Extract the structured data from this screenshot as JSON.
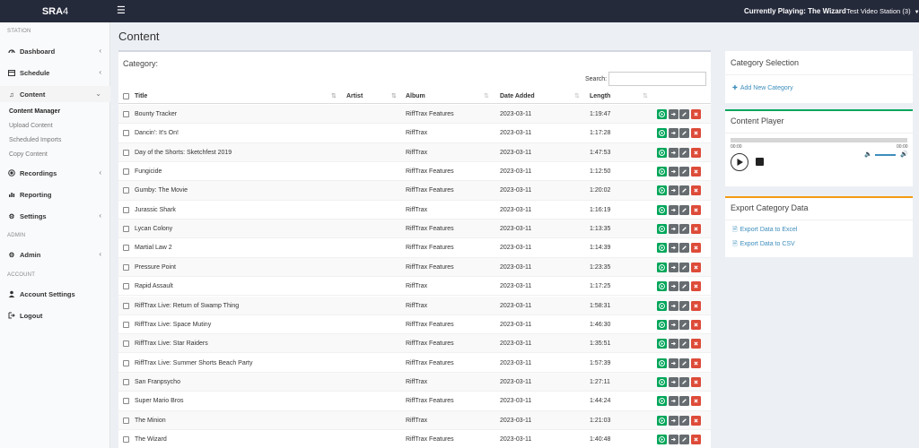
{
  "brand": {
    "bold": "SRA",
    "rest": "4"
  },
  "topbar": {
    "now_playing_label": "Currently Playing:",
    "now_playing_value": "The Wizard",
    "station": "Test Video Station (3)"
  },
  "sidebar": {
    "section_station": "STATION",
    "section_admin": "ADMIN",
    "section_account": "ACCOUNT",
    "dashboard": "Dashboard",
    "schedule": "Schedule",
    "content": "Content",
    "content_manager": "Content Manager",
    "upload_content": "Upload Content",
    "scheduled_imports": "Scheduled Imports",
    "copy_content": "Copy Content",
    "recordings": "Recordings",
    "reporting": "Reporting",
    "settings": "Settings",
    "admin": "Admin",
    "account_settings": "Account Settings",
    "logout": "Logout"
  },
  "page": {
    "title": "Content"
  },
  "content_box": {
    "title": "Category:",
    "search_label": "Search:",
    "search_value": "",
    "columns": {
      "title": "Title",
      "artist": "Artist",
      "album": "Album",
      "date_added": "Date Added",
      "length": "Length"
    },
    "rows": [
      {
        "title": "Bounty Tracker",
        "artist": "",
        "album": "RiffTrax Features",
        "date": "2023-03-11",
        "length": "1:19:47"
      },
      {
        "title": "Dancin': It's On!",
        "artist": "",
        "album": "RiffTrax",
        "date": "2023-03-11",
        "length": "1:17:28"
      },
      {
        "title": "Day of the Shorts: Sketchfest 2019",
        "artist": "",
        "album": "RiffTrax",
        "date": "2023-03-11",
        "length": "1:47:53"
      },
      {
        "title": "Fungicide",
        "artist": "",
        "album": "RiffTrax Features",
        "date": "2023-03-11",
        "length": "1:12:50"
      },
      {
        "title": "Gumby: The Movie",
        "artist": "",
        "album": "RiffTrax Features",
        "date": "2023-03-11",
        "length": "1:20:02"
      },
      {
        "title": "Jurassic Shark",
        "artist": "",
        "album": "RiffTrax",
        "date": "2023-03-11",
        "length": "1:16:19"
      },
      {
        "title": "Lycan Colony",
        "artist": "",
        "album": "RiffTrax Features",
        "date": "2023-03-11",
        "length": "1:13:35"
      },
      {
        "title": "Martial Law 2",
        "artist": "",
        "album": "RiffTrax Features",
        "date": "2023-03-11",
        "length": "1:14:39"
      },
      {
        "title": "Pressure Point",
        "artist": "",
        "album": "RiffTrax Features",
        "date": "2023-03-11",
        "length": "1:23:35"
      },
      {
        "title": "Rapid Assault",
        "artist": "",
        "album": "RiffTrax",
        "date": "2023-03-11",
        "length": "1:17:25"
      },
      {
        "title": "RiffTrax Live: Return of Swamp Thing",
        "artist": "",
        "album": "RiffTrax",
        "date": "2023-03-11",
        "length": "1:58:31"
      },
      {
        "title": "RiffTrax Live: Space Mutiny",
        "artist": "",
        "album": "RiffTrax Features",
        "date": "2023-03-11",
        "length": "1:46:30"
      },
      {
        "title": "RiffTrax Live: Star Raiders",
        "artist": "",
        "album": "RiffTrax Features",
        "date": "2023-03-11",
        "length": "1:35:51"
      },
      {
        "title": "RiffTrax Live: Summer Shorts Beach Party",
        "artist": "",
        "album": "RiffTrax Features",
        "date": "2023-03-11",
        "length": "1:57:39"
      },
      {
        "title": "San Franpsycho",
        "artist": "",
        "album": "RiffTrax",
        "date": "2023-03-11",
        "length": "1:27:11"
      },
      {
        "title": "Super Mario Bros",
        "artist": "",
        "album": "RiffTrax Features",
        "date": "2023-03-11",
        "length": "1:44:24"
      },
      {
        "title": "The Minion",
        "artist": "",
        "album": "RiffTrax",
        "date": "2023-03-11",
        "length": "1:21:03"
      },
      {
        "title": "The Wizard",
        "artist": "",
        "album": "RiffTrax Features",
        "date": "2023-03-11",
        "length": "1:40:48"
      }
    ]
  },
  "category_selection": {
    "title": "Category Selection",
    "add_link": "Add New Category"
  },
  "content_player": {
    "title": "Content Player",
    "time_current": "00:00",
    "time_total": "00:00",
    "progress": 0
  },
  "export": {
    "title": "Export Category Data",
    "excel": "Export Data to Excel",
    "csv": "Export Data to CSV"
  },
  "colors": {
    "topbar": "#252a3b",
    "accent_green": "#00a65a",
    "accent_orange": "#f39c12",
    "link": "#3c8dbc",
    "delete": "#dd4b39"
  },
  "icons": {
    "play": "play-icon",
    "move": "arrow-right-icon",
    "edit": "pencil-icon",
    "delete": "times-icon"
  }
}
